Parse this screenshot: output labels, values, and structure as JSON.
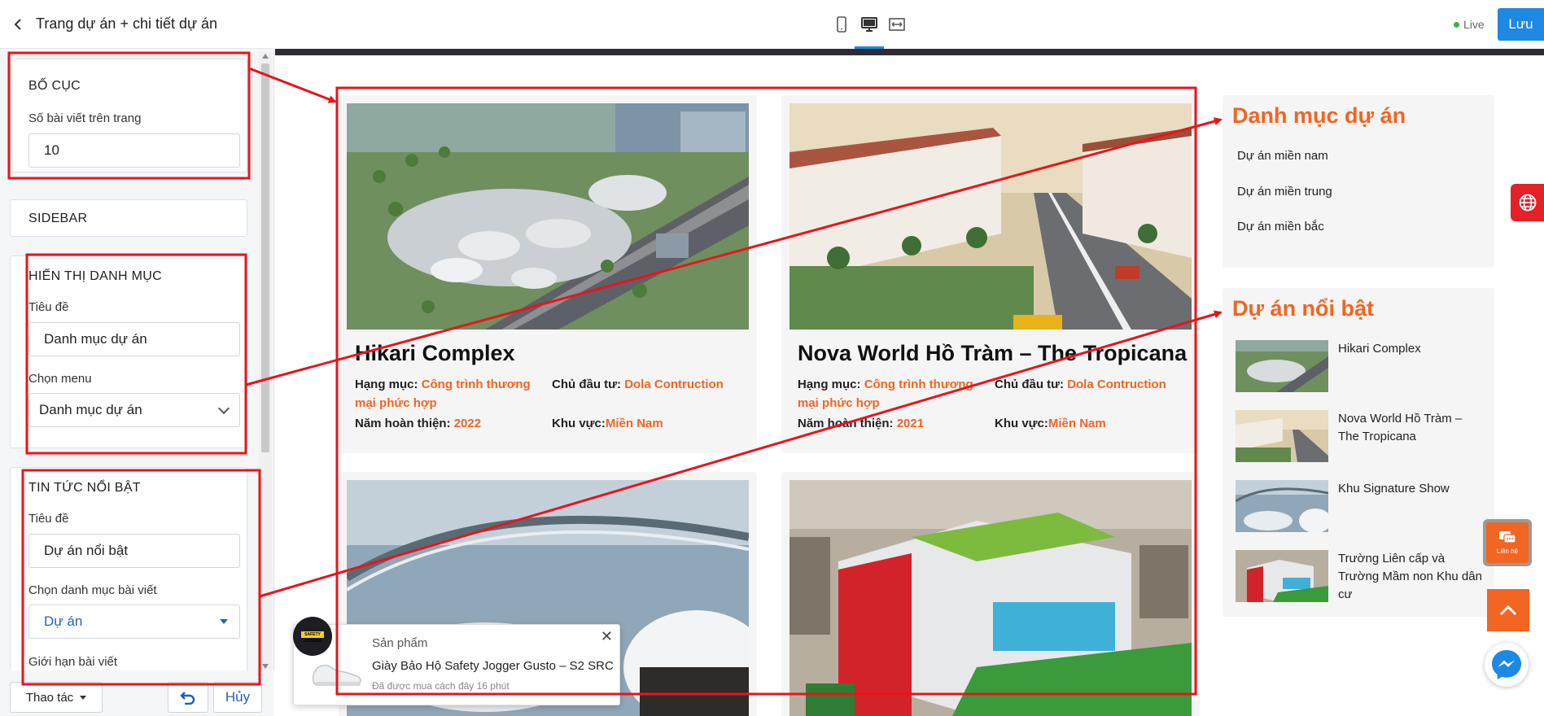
{
  "header": {
    "title": "Trang dự án + chi tiết dự án",
    "live": "Live",
    "save": "Lưu"
  },
  "view_icons": [
    "mobile-view-icon",
    "desktop-view-icon",
    "fullwidth-view-icon"
  ],
  "left_panel": {
    "layout": {
      "title": "BỐ CỤC",
      "label": "Số bài viết trên trang",
      "value": "10"
    },
    "sidebar": {
      "title": "SIDEBAR"
    },
    "category": {
      "title": "HIỂN THỊ DANH MỤC",
      "title_label": "Tiêu đề",
      "title_value": "Danh mục dự án",
      "menu_label": "Chọn menu",
      "menu_value": "Danh mục dự án"
    },
    "featured": {
      "title": "TIN TỨC NỔI BẬT",
      "title_label": "Tiêu đề",
      "title_value": "Dự án nổi bật",
      "cat_label": "Chọn danh mục bài viết",
      "cat_value": "Dự án",
      "limit_label": "Giới hạn bài viết"
    },
    "footer": {
      "actions": "Thao tác",
      "cancel": "Hủy"
    }
  },
  "projects": [
    {
      "title": "Hikari Complex",
      "cat_label": "Hạng mục:",
      "cat_line1": "Công trình thương mại",
      "cat_line2": "phức hợp",
      "investor_label": "Chủ đầu tư:",
      "investor": "Dola Contruction",
      "year_label": "Năm hoàn thiện:",
      "year": "2022",
      "region_label": "Khu vực:",
      "region": "Miền Nam"
    },
    {
      "title": "Nova World Hồ Tràm – The Tropicana",
      "cat_label": "Hạng mục:",
      "cat_line1": "Công trình thương mại",
      "cat_line2": "phức hợp",
      "investor_label": "Chủ đầu tư:",
      "investor": "Dola Contruction",
      "year_label": "Năm hoàn thiện:",
      "year": "2021",
      "region_label": "Khu vực:",
      "region": "Miền Nam"
    }
  ],
  "sidebar_widgets": {
    "categories": {
      "title": "Danh mục dự án",
      "items": [
        "Dự án miền nam",
        "Dự án miền trung",
        "Dự án miền bắc"
      ]
    },
    "featured": {
      "title": "Dự án nổi bật",
      "items": [
        "Hikari Complex",
        "Nova World Hồ Tràm – The Tropicana",
        "Khu Signature Show",
        "Trường Liên cấp và Trường Mầm non Khu dân cư"
      ]
    }
  },
  "popup": {
    "label": "Sản phẩm",
    "name": "Giày Bảo Hộ Safety Jogger Gusto – S2 SRC",
    "time": "Đã được mua cách đây 16 phút",
    "close": "✕",
    "avatar_text": "SAFETY JOGGER"
  },
  "floating": {
    "contact": "Liên hệ"
  },
  "colors": {
    "accent": "#f26522",
    "primary": "#1e88e5",
    "annotation": "#e8141b"
  }
}
